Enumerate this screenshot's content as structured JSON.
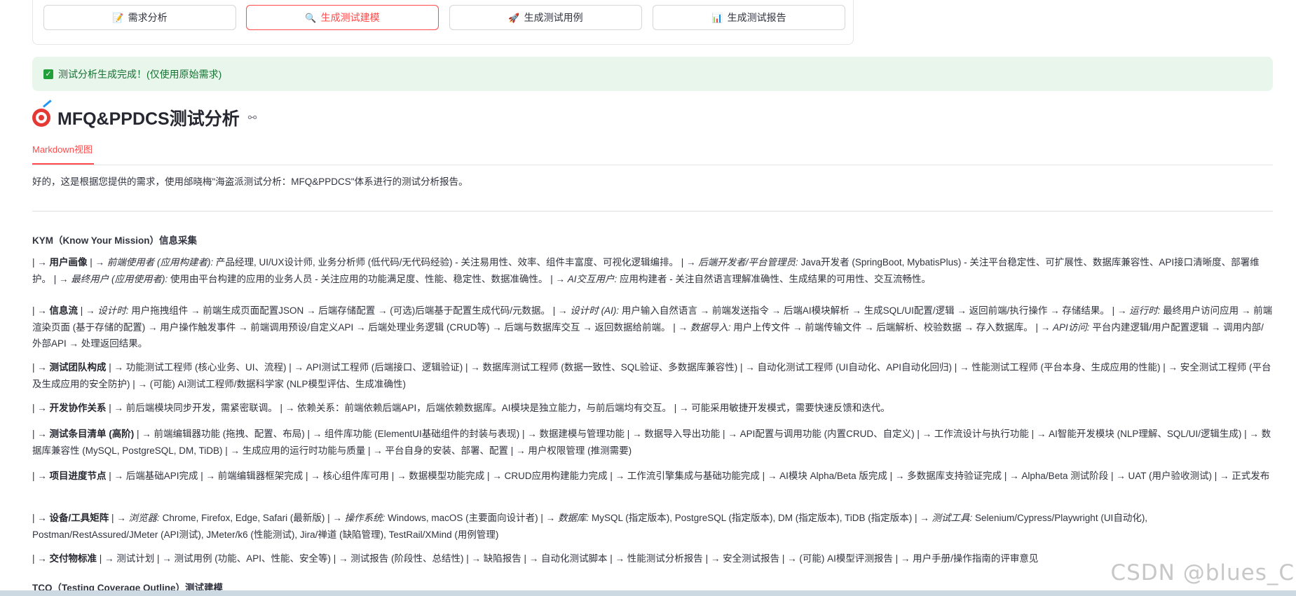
{
  "toolbar": {
    "buttons": [
      {
        "label": "需求分析",
        "icon": "memo-icon",
        "glyph": "📝"
      },
      {
        "label": "生成测试建模",
        "icon": "magnifier-icon",
        "glyph": "🔍"
      },
      {
        "label": "生成测试用例",
        "icon": "rocket-icon",
        "glyph": "🚀"
      },
      {
        "label": "生成测试报告",
        "icon": "bar-chart-icon",
        "glyph": "📊"
      }
    ],
    "active_index": 1
  },
  "alert": {
    "text": "测试分析生成完成！(仅使用原始需求)",
    "color": "#21a03a"
  },
  "header": {
    "title": "MFQ&PPDCS测试分析",
    "link_glyph": "⊖"
  },
  "tabs": [
    {
      "label": "Markdown视图"
    }
  ],
  "accent_color": "#ff4b4b",
  "content": {
    "intro": "好的，这是根据您提供的需求，使用邰晓梅\"海盗派测试分析：MFQ&PPDCS\"体系进行的测试分析报告。",
    "section1": "KYM（Know Your Mission）信息采集",
    "p1": {
      "lead": "| → ",
      "title": "用户画像",
      "a": " | → ",
      "b_i": "前端使用者 (应用构建者):",
      "c": " 产品经理, UI/UX设计师, 业务分析师 (低代码/无代码经验) - 关注易用性、效率、组件丰富度、可视化逻辑编排。 | → ",
      "d_i": "后端开发者/平台管理员:",
      "e": " Java开发者 (SpringBoot, MybatisPlus) - 关注平台稳定性、可扩展性、数据库兼容性、API接口清晰度、部署维护。 | → ",
      "f_i": "最终用户 (应用使用者):",
      "g": " 使用由平台构建的应用的业务人员 - 关注应用的功能满足度、性能、稳定性、数据准确性。 | → ",
      "h_i": "AI交互用户:",
      "j": " 应用构建者 - 关注自然语言理解准确性、生成结果的可用性、交互流畅性。"
    },
    "p2": {
      "lead": "| → ",
      "title": "信息流",
      "a": " | → ",
      "b_i": "设计时:",
      "c": " 用户拖拽组件 → 前端生成页面配置JSON → 后端存储配置 → (可选)后端基于配置生成代码/元数据。 | → ",
      "d_i": "设计时 (AI):",
      "e": " 用户输入自然语言 → 前端发送指令 → 后端AI模块解析 → 生成SQL/UI配置/逻辑 → 返回前端/执行操作 → 存储结果。 | → ",
      "f_i": "运行时:",
      "g": " 最终用户访问应用 → 前端渲染页面 (基于存储的配置) → 用户操作触发事件 → 前端调用预设/自定义API → 后端处理业务逻辑 (CRUD等) → 后端与数据库交互 → 返回数据给前端。 | → ",
      "h_i": "数据导入:",
      "j": " 用户上传文件 → 前端传输文件 → 后端解析、校验数据 → 存入数据库。 | → ",
      "k_i": "API访问:",
      "l": " 平台内建逻辑/用户配置逻辑 → 调用内部/外部API → 处理返回结果。"
    },
    "p3": {
      "lead": "| → ",
      "title": "测试团队构成",
      "rest": " | → 功能测试工程师 (核心业务、UI、流程) | → API测试工程师 (后端接口、逻辑验证) | → 数据库测试工程师 (数据一致性、SQL验证、多数据库兼容性) | → 自动化测试工程师 (UI自动化、API自动化回归) | → 性能测试工程师 (平台本身、生成应用的性能) | → 安全测试工程师 (平台及生成应用的安全防护) | → (可能) AI测试工程师/数据科学家 (NLP模型评估、生成准确性)"
    },
    "p4": {
      "lead": "| → ",
      "title": "开发协作关系",
      "rest": " | → 前后端模块同步开发，需紧密联调。 | → 依赖关系：前端依赖后端API，后端依赖数据库。AI模块是独立能力，与前后端均有交互。 | → 可能采用敏捷开发模式，需要快速反馈和迭代。"
    },
    "p5": {
      "lead": "| → ",
      "title": "测试条目清单 (高阶)",
      "rest": " | → 前端编辑器功能 (拖拽、配置、布局) | → 组件库功能 (ElementUI基础组件的封装与表现) | → 数据建模与管理功能 | → 数据导入导出功能 | → API配置与调用功能 (内置CRUD、自定义) | → 工作流设计与执行功能 | → AI智能开发模块 (NLP理解、SQL/UI/逻辑生成) | → 数据库兼容性 (MySQL, PostgreSQL, DM, TiDB) | → 生成应用的运行时功能与质量 | → 平台自身的安装、部署、配置 | → 用户权限管理 (推测需要)"
    },
    "p6": {
      "lead": "| → ",
      "title": "项目进度节点",
      "rest": " | → 后端基础API完成 | → 前端编辑器框架完成 | → 核心组件库可用 | → 数据模型功能完成 | → CRUD应用构建能力完成 | → 工作流引擎集成与基础功能完成 | → AI模块 Alpha/Beta 版完成 | → 多数据库支持验证完成 | → Alpha/Beta 测试阶段 | → UAT (用户验收测试) | → 正式发布"
    },
    "p7": {
      "lead": "| → ",
      "title": "设备/工具矩阵",
      "a": " | → ",
      "b_i": "浏览器:",
      "c": " Chrome, Firefox, Edge, Safari (最新版) | → ",
      "d_i": "操作系统:",
      "e": " Windows, macOS (主要面向设计者) | → ",
      "f_i": "数据库:",
      "g": " MySQL (指定版本), PostgreSQL (指定版本), DM (指定版本), TiDB (指定版本) | → ",
      "h_i": "测试工具:",
      "j": " Selenium/Cypress/Playwright (UI自动化), Postman/RestAssured/JMeter (API测试), JMeter/k6 (性能测试), Jira/禅道 (缺陷管理), TestRail/XMind (用例管理)"
    },
    "p8": {
      "lead": "| → ",
      "title": "交付物标准",
      "rest": " | → 测试计划 | → 测试用例 (功能、API、性能、安全等) | → 测试报告 (阶段性、总结性) | → 缺陷报告 | → 自动化测试脚本 | → 性能测试分析报告 | → 安全测试报告 | → (可能) AI模型评测报告 | → 用户手册/操作指南的评审意见"
    },
    "section2": "TCO（Testing Coverage Outline）测试建模"
  },
  "watermark": "CSDN @blues_C"
}
